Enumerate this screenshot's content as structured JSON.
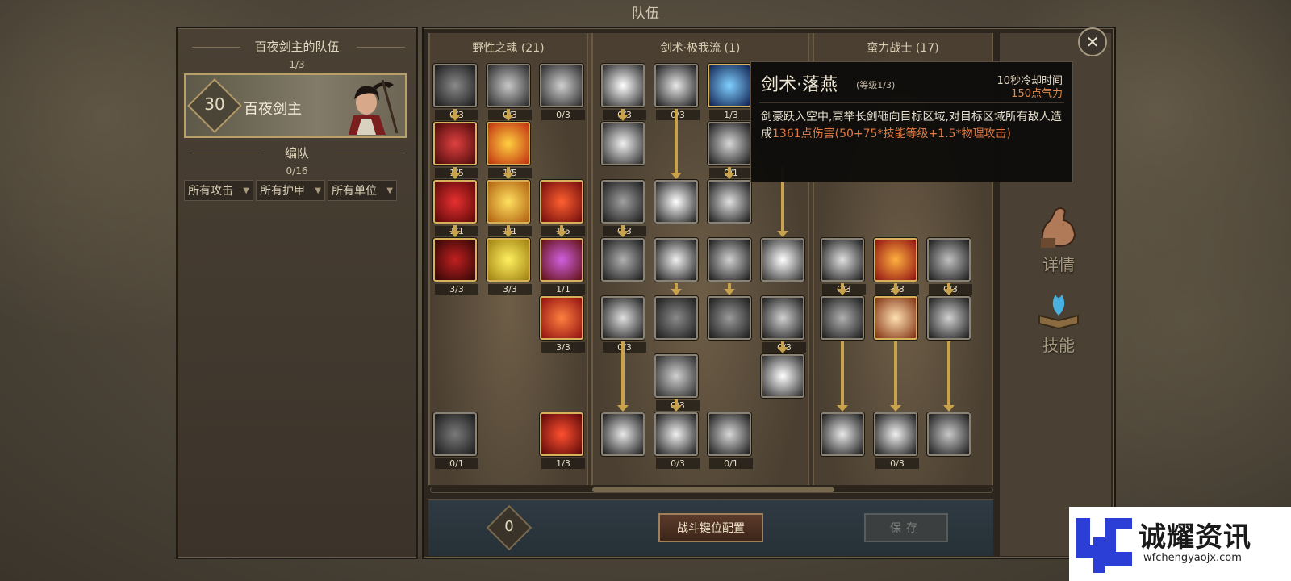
{
  "title": "队伍",
  "team": {
    "name": "百夜剑主的队伍",
    "count": "1/3",
    "hero": {
      "level": "30",
      "name": "百夜剑主"
    },
    "group_title": "编队",
    "group_count": "0/16",
    "filters": [
      "所有攻击",
      "所有护甲",
      "所有单位"
    ]
  },
  "trees": [
    {
      "name": "野性之魂 (21)"
    },
    {
      "name": "剑术·极我流 (1)"
    },
    {
      "name": "蛮力战士 (17)"
    }
  ],
  "skills": {
    "col1": [
      "0/3",
      "0/3",
      "0/3",
      "1/5",
      "1/5",
      "1/1",
      "1/1",
      "1/5",
      "3/3",
      "3/3",
      "1/1",
      "3/3",
      "0/1",
      "1/3"
    ],
    "col2": [
      "0/3",
      "0/3",
      "1/3",
      "0/1",
      "0/3",
      "0/3",
      "0/3",
      "0/3",
      "0/3",
      "0/1"
    ],
    "col3": [
      "0/3",
      "3/3",
      "0/3",
      "0/3"
    ]
  },
  "points": "0",
  "buttons": {
    "keybind": "战斗键位配置",
    "save": "保存"
  },
  "side_tabs": {
    "details": "详情",
    "skills": "技能"
  },
  "tooltip": {
    "name": "剑术·落燕",
    "level": "(等级1/3)",
    "cooldown": "10秒冷却时间",
    "cost": "150点气力",
    "desc_prefix": "剑豪跃入空中,高举长剑砸向目标区域,对目标区域所有敌人造成",
    "desc_damage": "1361点伤害(50+75*技能等级+1.5*物理攻击)"
  },
  "watermark": {
    "title": "诚耀资讯",
    "url": "wfchengyaojx.com"
  },
  "colors": {
    "gold": "#c9a24c",
    "damage": "#e07a46"
  }
}
